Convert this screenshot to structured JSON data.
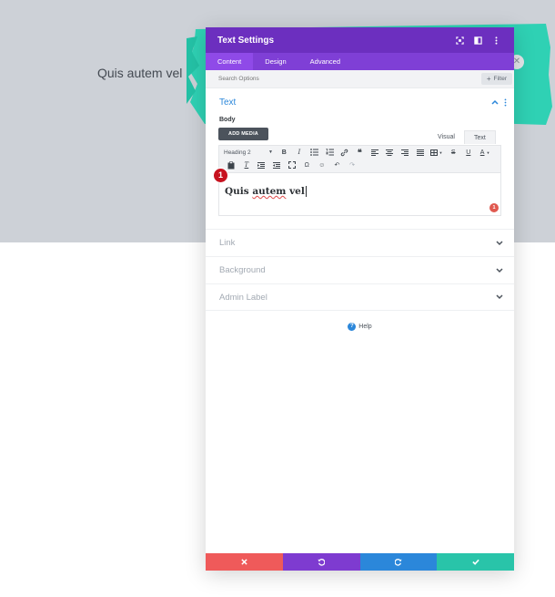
{
  "background": {
    "heading": "Quis autem vel"
  },
  "modal": {
    "title": "Text Settings",
    "tabs": [
      "Content",
      "Design",
      "Advanced"
    ],
    "active_tab": "Content",
    "search": {
      "placeholder": "Search Options"
    },
    "filter_label": "Filter",
    "text_section": {
      "title": "Text",
      "body_label": "Body",
      "add_media_label": "ADD MEDIA",
      "mode_tabs": [
        "Visual",
        "Text"
      ],
      "active_mode": "Text",
      "format_select": "Heading 2",
      "editor_content": {
        "word1": "Quis",
        "word2": "autem",
        "word3": "vel"
      },
      "notification_count": "1"
    },
    "step_number": "1",
    "accordions": [
      "Link",
      "Background",
      "Admin Label"
    ],
    "help_label": "Help",
    "colors": {
      "header": "#6c2fbf",
      "tabs": "#7f3fd6",
      "accent": "#2b87da",
      "cancel": "#ef5a5a",
      "undo": "#7e3bd0",
      "redo": "#2b87da",
      "save": "#29c4a9"
    }
  }
}
